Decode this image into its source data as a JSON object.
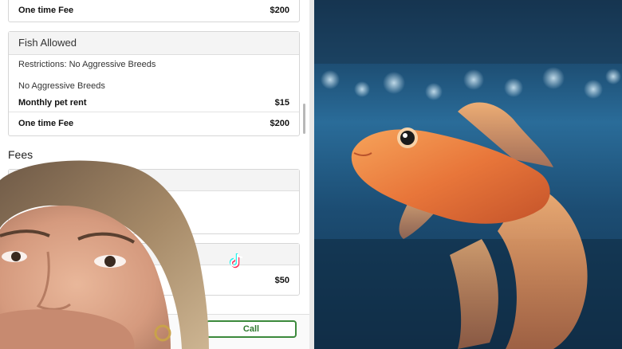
{
  "pet_policy": {
    "top_row": {
      "label": "One time Fee",
      "value": "$200"
    },
    "fish": {
      "header": "Fish Allowed",
      "restrictions": "Restrictions: No Aggressive Breeds",
      "note": "No Aggressive Breeds",
      "monthly": {
        "label": "Monthly pet rent",
        "value": "$15"
      },
      "onetime": {
        "label": "One time Fee",
        "value": "$200"
      }
    }
  },
  "fees": {
    "title": "Fees",
    "visible_value": "$50"
  },
  "actions": {
    "call_label": "Call"
  },
  "overlay": {
    "tiktok_icon": "tiktok-logo-icon"
  },
  "colors": {
    "call_green": "#3c8a3c",
    "card_header_bg": "#f4f4f4"
  }
}
